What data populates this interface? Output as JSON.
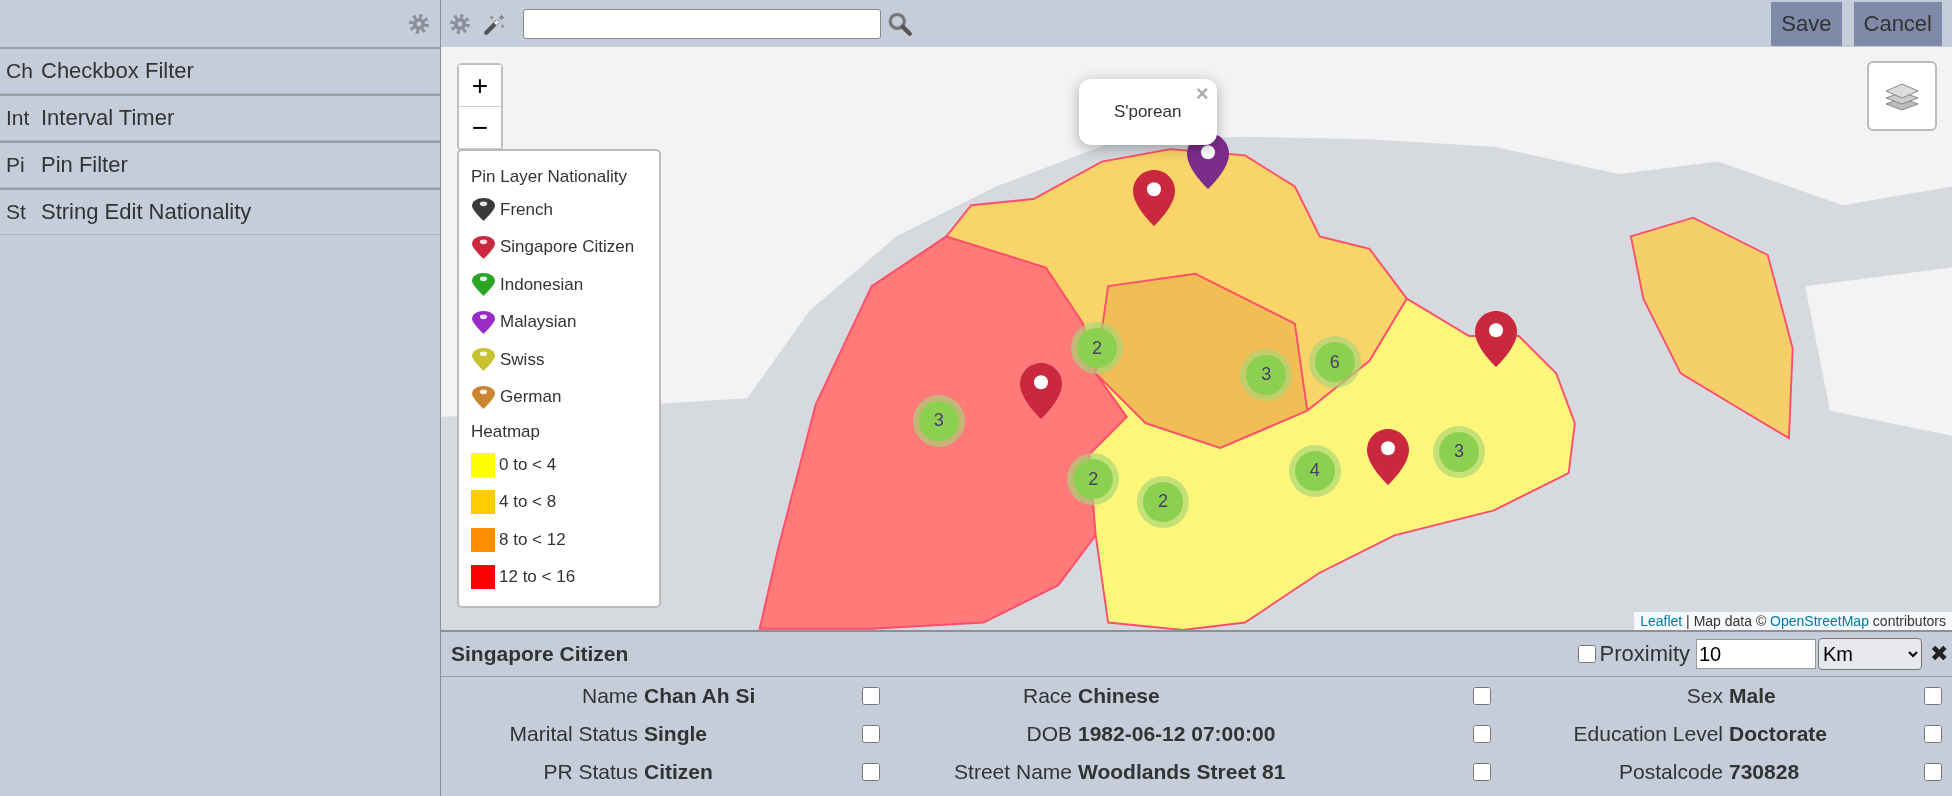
{
  "sidebar": {
    "items": [
      {
        "short": "Ch",
        "label": "Checkbox Filter"
      },
      {
        "short": "Int",
        "label": "Interval Timer"
      },
      {
        "short": "Pi",
        "label": "Pin Filter"
      },
      {
        "short": "St",
        "label": "String Edit Nationality"
      }
    ]
  },
  "toolbar": {
    "buttons": [
      "Save",
      "Cancel"
    ]
  },
  "map": {
    "zoom_controls": [
      "+",
      "−"
    ],
    "popup": {
      "text": "S'porean",
      "close": "×"
    },
    "legend": {
      "pin_title": "Pin Layer Nationality",
      "pins": [
        {
          "label": "French",
          "color": "#3a3a3a"
        },
        {
          "label": "Singapore Citizen",
          "color": "#c9283e"
        },
        {
          "label": "Indonesian",
          "color": "#2aa524"
        },
        {
          "label": "Malaysian",
          "color": "#9a2bc9"
        },
        {
          "label": "Swiss",
          "color": "#c9c230"
        },
        {
          "label": "German",
          "color": "#cb8432"
        }
      ],
      "heatmap_title": "Heatmap",
      "bands": [
        {
          "label": "0 to < 4",
          "color": "#ffff00"
        },
        {
          "label": "4 to < 8",
          "color": "#ffcc00"
        },
        {
          "label": "8 to < 12",
          "color": "#ff8c00"
        },
        {
          "label": "12 to < 16",
          "color": "#ff0000"
        }
      ]
    },
    "clusters": [
      {
        "count": "3"
      },
      {
        "count": "2"
      },
      {
        "count": "2"
      },
      {
        "count": "2"
      },
      {
        "count": "3"
      },
      {
        "count": "6"
      },
      {
        "count": "4"
      },
      {
        "count": "3"
      }
    ],
    "pins": [
      {
        "color": "#c9283e"
      },
      {
        "color": "#7b2c8c"
      },
      {
        "color": "#c9283e"
      },
      {
        "color": "#c9283e"
      },
      {
        "color": "#c9283e"
      }
    ],
    "attribution": {
      "leaflet_link": "Leaflet",
      "text": "| Map data ©",
      "osm_link": "OpenStreetMap",
      "suffix": "contributors"
    }
  },
  "detail": {
    "title": "Singapore Citizen",
    "proximity": {
      "label": "Proximity",
      "checked": false,
      "value": "10",
      "unit": "Km"
    },
    "close": "✖",
    "fields": [
      {
        "label": "Name",
        "value": "Chan Ah Si",
        "checked": false
      },
      {
        "label": "Race",
        "value": "Chinese",
        "checked": false
      },
      {
        "label": "Sex",
        "value": "Male",
        "checked": false
      },
      {
        "label": "Marital Status",
        "value": "Single",
        "checked": false
      },
      {
        "label": "DOB",
        "value": "1982-06-12 07:00:00",
        "checked": false
      },
      {
        "label": "Education Level",
        "value": "Doctorate",
        "checked": false
      },
      {
        "label": "PR Status",
        "value": "Citizen",
        "checked": false
      },
      {
        "label": "Street Name",
        "value": "Woodlands Street 81",
        "checked": false
      },
      {
        "label": "Postalcode",
        "value": "730828",
        "checked": false
      }
    ]
  }
}
